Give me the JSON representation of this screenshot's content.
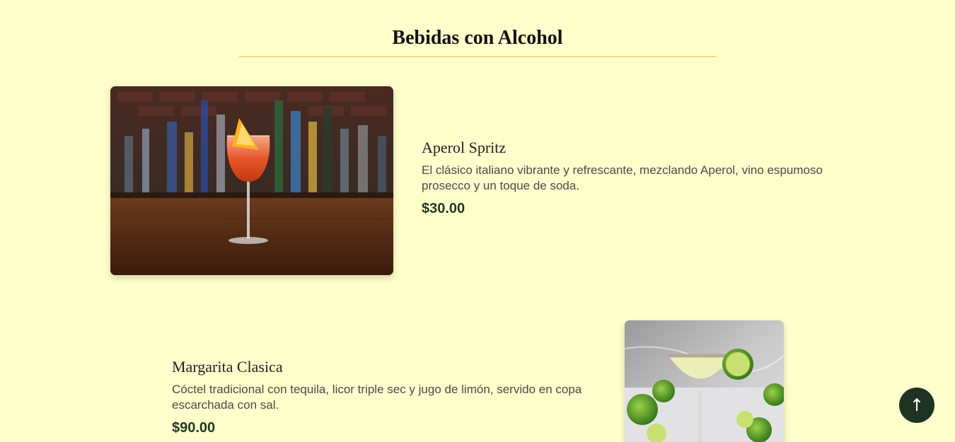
{
  "section": {
    "title": "Bebidas con Alcohol"
  },
  "items": [
    {
      "name": "Aperol Spritz",
      "description": "El clásico italiano vibrante y refrescante, mezclando Aperol, vino espumoso prosecco y un toque de soda.",
      "price": "$30.00",
      "image": "aperol-spritz-photo"
    },
    {
      "name": "Margarita Clasica",
      "description": "Cóctel tradicional con tequila, licor triple sec y jugo de limón, servido en copa escarchada con sal.",
      "price": "$90.00",
      "image": "margarita-photo"
    }
  ],
  "scroll_top": {
    "icon": "arrow-up-icon",
    "glyph": "↑"
  },
  "colors": {
    "background": "#ffffcc",
    "title_rule": "#f2d98a",
    "price": "#1f3a22",
    "scroll_button": "#1f3323"
  }
}
